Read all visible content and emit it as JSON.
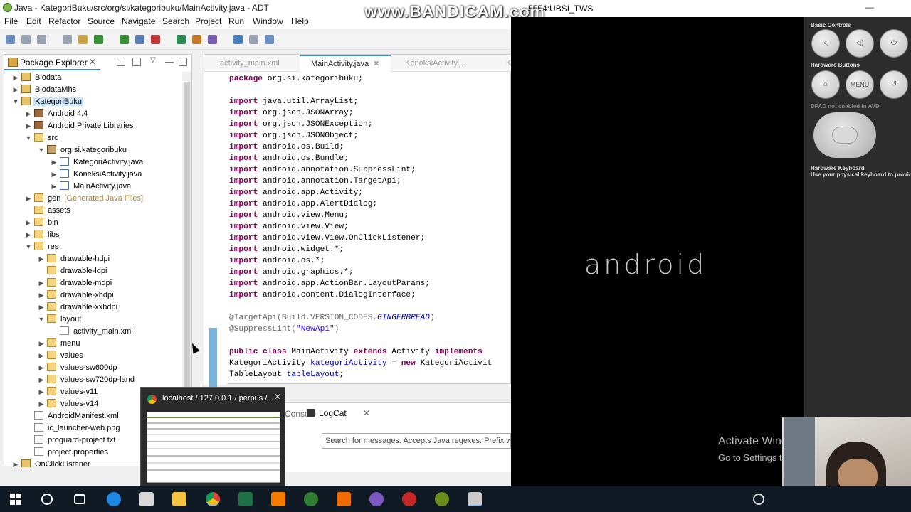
{
  "adt": {
    "title": "Java - KategoriBuku/src/org/si/kategoribuku/MainActivity.java - ADT",
    "menu": [
      "File",
      "Edit",
      "Refactor",
      "Source",
      "Navigate",
      "Search",
      "Project",
      "Run",
      "Window",
      "Help"
    ]
  },
  "package_explorer": {
    "tab_label": "Package Explorer",
    "tree": [
      {
        "label": "Biodata",
        "depth": 0,
        "arrow": "right",
        "icon": "proj"
      },
      {
        "label": "BiodataMhs",
        "depth": 0,
        "arrow": "right",
        "icon": "proj"
      },
      {
        "label": "KategoriBuku",
        "depth": 0,
        "arrow": "down",
        "icon": "proj",
        "selected": true
      },
      {
        "label": "Android 4.4",
        "depth": 1,
        "arrow": "right",
        "icon": "jar"
      },
      {
        "label": "Android Private Libraries",
        "depth": 1,
        "arrow": "right",
        "icon": "jar"
      },
      {
        "label": "src",
        "depth": 1,
        "arrow": "down",
        "icon": "fold"
      },
      {
        "label": "org.si.kategoribuku",
        "depth": 2,
        "arrow": "down",
        "icon": "pkg"
      },
      {
        "label": "KategoriActivity.java",
        "depth": 3,
        "arrow": "right",
        "icon": "java"
      },
      {
        "label": "KoneksiActivity.java",
        "depth": 3,
        "arrow": "right",
        "icon": "java"
      },
      {
        "label": "MainActivity.java",
        "depth": 3,
        "arrow": "right",
        "icon": "java"
      },
      {
        "label": "gen",
        "suffix": "[Generated Java Files]",
        "depth": 1,
        "arrow": "right",
        "icon": "fold"
      },
      {
        "label": "assets",
        "depth": 1,
        "arrow": "",
        "icon": "fold"
      },
      {
        "label": "bin",
        "depth": 1,
        "arrow": "right",
        "icon": "fold"
      },
      {
        "label": "libs",
        "depth": 1,
        "arrow": "right",
        "icon": "fold"
      },
      {
        "label": "res",
        "depth": 1,
        "arrow": "down",
        "icon": "fold"
      },
      {
        "label": "drawable-hdpi",
        "depth": 2,
        "arrow": "right",
        "icon": "fold"
      },
      {
        "label": "drawable-ldpi",
        "depth": 2,
        "arrow": "",
        "icon": "fold"
      },
      {
        "label": "drawable-mdpi",
        "depth": 2,
        "arrow": "right",
        "icon": "fold"
      },
      {
        "label": "drawable-xhdpi",
        "depth": 2,
        "arrow": "right",
        "icon": "fold"
      },
      {
        "label": "drawable-xxhdpi",
        "depth": 2,
        "arrow": "right",
        "icon": "fold"
      },
      {
        "label": "layout",
        "depth": 2,
        "arrow": "down",
        "icon": "fold"
      },
      {
        "label": "activity_main.xml",
        "depth": 3,
        "arrow": "",
        "icon": "file"
      },
      {
        "label": "menu",
        "depth": 2,
        "arrow": "right",
        "icon": "fold"
      },
      {
        "label": "values",
        "depth": 2,
        "arrow": "right",
        "icon": "fold"
      },
      {
        "label": "values-sw600dp",
        "depth": 2,
        "arrow": "right",
        "icon": "fold"
      },
      {
        "label": "values-sw720dp-land",
        "depth": 2,
        "arrow": "right",
        "icon": "fold"
      },
      {
        "label": "values-v11",
        "depth": 2,
        "arrow": "right",
        "icon": "fold"
      },
      {
        "label": "values-v14",
        "depth": 2,
        "arrow": "right",
        "icon": "fold"
      },
      {
        "label": "AndroidManifest.xml",
        "depth": 1,
        "arrow": "",
        "icon": "file"
      },
      {
        "label": "ic_launcher-web.png",
        "depth": 1,
        "arrow": "",
        "icon": "file"
      },
      {
        "label": "proguard-project.txt",
        "depth": 1,
        "arrow": "",
        "icon": "file"
      },
      {
        "label": "project.properties",
        "depth": 1,
        "arrow": "",
        "icon": "file"
      },
      {
        "label": "OnClickListener",
        "depth": 0,
        "arrow": "right",
        "icon": "proj"
      }
    ]
  },
  "editor": {
    "tabs": [
      {
        "label": "activity_main.xml",
        "active": false
      },
      {
        "label": "MainActivity.java",
        "active": true
      },
      {
        "label": "KoneksiActivity.j...",
        "active": false
      },
      {
        "label": "Ka",
        "active": false
      }
    ],
    "lines": [
      "package org.si.kategoribuku;",
      "",
      "import java.util.ArrayList;",
      "import org.json.JSONArray;",
      "import org.json.JSONException;",
      "import org.json.JSONObject;",
      "import android.os.Build;",
      "import android.os.Bundle;",
      "import android.annotation.SuppressLint;",
      "import android.annotation.TargetApi;",
      "import android.app.Activity;",
      "import android.app.AlertDialog;",
      "import android.view.Menu;",
      "import android.view.View;",
      "import android.view.View.OnClickListener;",
      "import android.widget.*;",
      "import android.os.*;",
      "import android.graphics.*;",
      "import android.app.ActionBar.LayoutParams;",
      "import android.content.DialogInterface;",
      "",
      "@TargetApi(Build.VERSION_CODES.GINGERBREAD)",
      "@SuppressLint(\"NewApi\")",
      "",
      "public class MainActivity extends Activity implements",
      "KategoriActivity kategoriActivity = new KategoriActivit",
      "TableLayout tableLayout;"
    ]
  },
  "console": {
    "tab_console": "Console",
    "tab_logcat": "LogCat",
    "search_placeholder": "Search for messages. Accepts Java regexes. Prefix with"
  },
  "taskbar_preview": {
    "title": "localhost / 127.0.0.1 / perpus / ..."
  },
  "emulator": {
    "title": "5554:UBSI_TWS",
    "boot_text": "android",
    "basic_controls": "Basic Controls",
    "hardware_buttons": "Hardware Buttons",
    "dpad_note": "DPAD not enabled in AVD",
    "menu_label": "MENU",
    "hw_keyboard": "Hardware Keyboard",
    "hw_keyboard_note": "Use your physical keyboard to provide input"
  },
  "overlay": {
    "watermark": "www.BANDICAM.com",
    "activate_title": "Activate Windows",
    "activate_sub": "Go to Settings to activate Windows."
  },
  "colors": {
    "accent": "#3d82d6",
    "taskbar": "#0f1a24",
    "keyword": "#7f0055",
    "string": "#2a00ff"
  }
}
